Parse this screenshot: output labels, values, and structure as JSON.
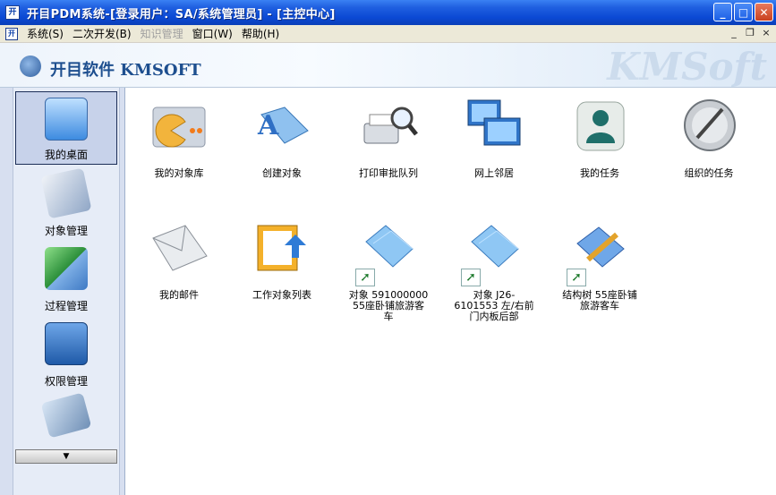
{
  "window": {
    "title": "开目PDM系统-[登录用户：SA/系统管理员] - [主控中心]",
    "app_icon_text": "开",
    "controls": {
      "minimize": "_",
      "maximize": "□",
      "close": "✕"
    }
  },
  "menubar": {
    "icon_text": "开",
    "items": [
      {
        "label": "系统(S)",
        "disabled": false
      },
      {
        "label": "二次开发(B)",
        "disabled": false
      },
      {
        "label": "知识管理",
        "disabled": true
      },
      {
        "label": "窗口(W)",
        "disabled": false
      },
      {
        "label": "帮助(H)",
        "disabled": false
      }
    ],
    "mdi": {
      "minimize": "_",
      "restore": "❐",
      "close": "×"
    }
  },
  "banner": {
    "title": "开目软件 KMSOFT",
    "watermark": "KMSoft"
  },
  "sidebar": {
    "items": [
      {
        "label": "我的桌面",
        "icon": "desktop-icon",
        "selected": true
      },
      {
        "label": "对象管理",
        "icon": "object-manage-icon",
        "selected": false
      },
      {
        "label": "过程管理",
        "icon": "process-manage-icon",
        "selected": false
      },
      {
        "label": "权限管理",
        "icon": "permission-manage-icon",
        "selected": false
      },
      {
        "label": "",
        "icon": "tablet-icon",
        "selected": false
      }
    ],
    "scroll_arrow": "▼"
  },
  "desktop": {
    "items": [
      {
        "label": "我的对象库",
        "icon": "pacman-folder-icon",
        "shortcut": false
      },
      {
        "label": "创建对象",
        "icon": "create-object-folder-icon",
        "shortcut": false
      },
      {
        "label": "打印审批队列",
        "icon": "printer-magnifier-icon",
        "shortcut": false
      },
      {
        "label": "网上邻居",
        "icon": "network-neighbor-icon",
        "shortcut": false
      },
      {
        "label": "我的任务",
        "icon": "user-task-icon",
        "shortcut": false
      },
      {
        "label": "组织的任务",
        "icon": "org-task-icon",
        "shortcut": false
      },
      {
        "label": "我的邮件",
        "icon": "mail-envelope-icon",
        "shortcut": false
      },
      {
        "label": "工作对象列表",
        "icon": "work-object-list-icon",
        "shortcut": false
      },
      {
        "label": "对象 591000000\n55座卧铺旅游客\n车",
        "icon": "folder-icon",
        "shortcut": true
      },
      {
        "label": "对象 J26-\n6101553 左/右前\n门内板后部",
        "icon": "folder-icon",
        "shortcut": true
      },
      {
        "label": "结构树 55座卧铺\n旅游客车",
        "icon": "structure-tree-icon",
        "shortcut": true
      }
    ]
  },
  "colors": {
    "titlebar": "#0b49d4",
    "menubar": "#ece9d8",
    "sidebar": "#d7dff0",
    "sidebar_selected": "#c7d2ea"
  }
}
